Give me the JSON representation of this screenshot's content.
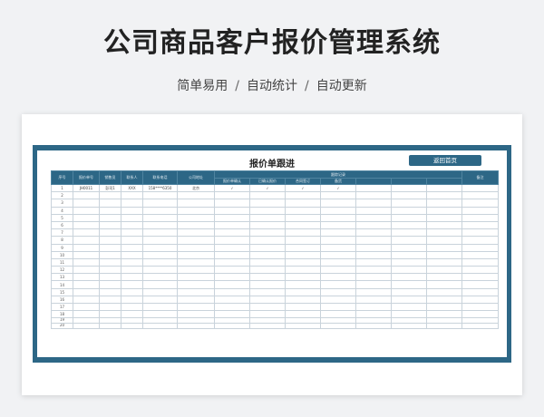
{
  "header": {
    "title": "公司商品客户报价管理系统",
    "subtitle_parts": [
      "简单易用",
      "自动统计",
      "自动更新"
    ],
    "separator": "/"
  },
  "sheet": {
    "title": "报价单跟进",
    "back_button": "返回首页",
    "columns": [
      "序号",
      "报价单号",
      "销售员",
      "联系人",
      "联系电话",
      "公司地址",
      "跟踪记录",
      "备注"
    ],
    "sub_columns": [
      "报价单确认",
      "已确认报价",
      "合同签订",
      "备货",
      "",
      "",
      ""
    ],
    "rows": [
      [
        "1",
        "JH0011",
        "彭司1",
        "XXX",
        "158****6350",
        "北京",
        "✓",
        "✓",
        "✓",
        "✓",
        "",
        "",
        "",
        ""
      ],
      [
        "2"
      ],
      [
        "3"
      ],
      [
        "4"
      ],
      [
        "5"
      ],
      [
        "6"
      ],
      [
        "7"
      ],
      [
        "8"
      ],
      [
        "9"
      ],
      [
        "10"
      ],
      [
        "11"
      ],
      [
        "12"
      ],
      [
        "13"
      ],
      [
        "14"
      ],
      [
        "15"
      ],
      [
        "16"
      ],
      [
        "17"
      ],
      [
        "18"
      ],
      [
        "19"
      ],
      [
        "20"
      ]
    ]
  }
}
